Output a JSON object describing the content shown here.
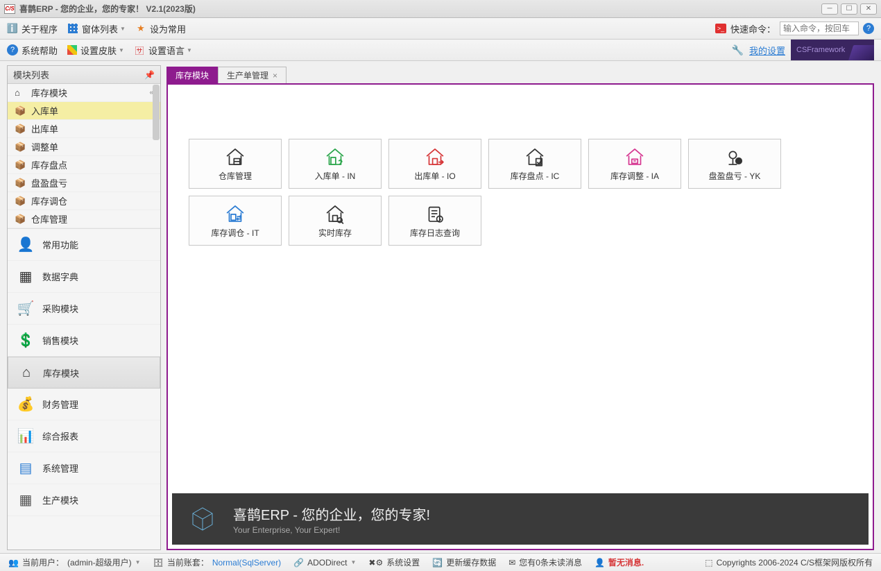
{
  "window": {
    "title": "喜鹊ERP - 您的企业，您的专家！ V2.1(2023版)"
  },
  "menu": {
    "about": "关于程序",
    "formlist": "窗体列表",
    "setdefault": "设为常用",
    "syshelp": "系统帮助",
    "setskin": "设置皮肤",
    "setlang": "设置语言",
    "quickcmd_label": "快速命令：",
    "quickcmd_placeholder": "输入命令，按回车",
    "mysettings": "我的设置",
    "csframework": "CSFramework"
  },
  "sidebar": {
    "title": "模块列表",
    "tree_header": "库存模块",
    "tree": [
      {
        "label": "入库单",
        "selected": true
      },
      {
        "label": "出库单"
      },
      {
        "label": "调整单"
      },
      {
        "label": "库存盘点"
      },
      {
        "label": "盘盈盘亏"
      },
      {
        "label": "库存调仓"
      },
      {
        "label": "仓库管理"
      }
    ],
    "modules": [
      {
        "label": "常用功能",
        "color": "#2ba7d3"
      },
      {
        "label": "数据字典",
        "color": "#333"
      },
      {
        "label": "采购模块",
        "color": "#e67e22"
      },
      {
        "label": "销售模块",
        "color": "#2aa57a"
      },
      {
        "label": "库存模块",
        "color": "#333",
        "selected": true
      },
      {
        "label": "财务管理",
        "color": "#2aa57a"
      },
      {
        "label": "综合报表",
        "color": "#3a7bd5"
      },
      {
        "label": "系统管理",
        "color": "#2b7cd3"
      },
      {
        "label": "生产模块",
        "color": "#555"
      }
    ]
  },
  "tabs": [
    {
      "label": "库存模块",
      "active": true,
      "closable": false
    },
    {
      "label": "生产单管理",
      "active": false,
      "closable": true
    }
  ],
  "tiles": [
    {
      "label": "仓库管理",
      "icon": "warehouse",
      "color": "#333"
    },
    {
      "label": "入库单 - IN",
      "icon": "in",
      "color": "#2aa54a"
    },
    {
      "label": "出库单 - IO",
      "icon": "out",
      "color": "#d63638"
    },
    {
      "label": "库存盘点 - IC",
      "icon": "check",
      "color": "#333"
    },
    {
      "label": "库存调整 - IA",
      "icon": "adjust",
      "color": "#d63690"
    },
    {
      "label": "盘盈盘亏 - YK",
      "icon": "balance",
      "color": "#333"
    },
    {
      "label": "库存调仓 - IT",
      "icon": "transfer",
      "color": "#2b7cd3"
    },
    {
      "label": "实时库存",
      "icon": "realtime",
      "color": "#333"
    },
    {
      "label": "库存日志查询",
      "icon": "log",
      "color": "#333"
    }
  ],
  "banner": {
    "line1": "喜鹊ERP - 您的企业，您的专家!",
    "line2": "Your Enterprise, Your Expert!"
  },
  "status": {
    "user_label": "当前用户：",
    "user_value": "(admin-超级用户)",
    "acct_label": "当前账套：",
    "acct_value": "Normal(SqlServer)",
    "ado": "ADODirect",
    "sysset": "系统设置",
    "refresh": "更新缓存数据",
    "msgs": "您有0条未读消息",
    "nomsg": "暂无消息.",
    "copyright": "Copyrights 2006-2024 C/S框架网版权所有"
  }
}
